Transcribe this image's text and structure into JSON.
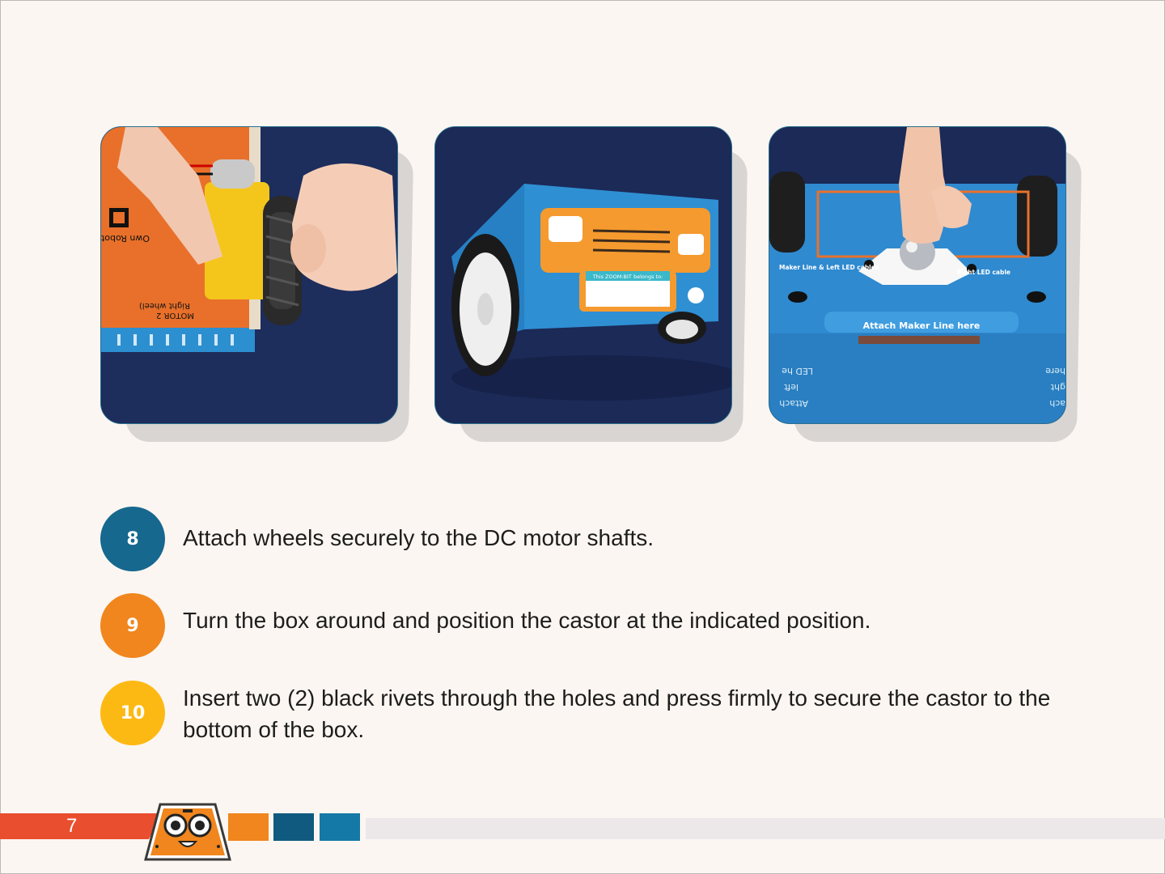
{
  "steps": [
    {
      "number": "8",
      "text": "Attach wheels securely to the DC motor shafts.",
      "color": "#16688e"
    },
    {
      "number": "9",
      "text": "Turn the box around and position the castor at the indicated position.",
      "color": "#f0861d"
    },
    {
      "number": "10",
      "text": "Insert two (2) black rivets through the holes and press firmly to secure the castor to the bottom of the box.",
      "color": "#fdb913"
    }
  ],
  "photos": {
    "photo1": {
      "motor_label": "MOTOR 2",
      "wheel_label": "Right wheel)",
      "robot_label": "Own Robot, for"
    },
    "photo2": {
      "plate_label": "This ZOOM:BIT belongs to:"
    },
    "photo3": {
      "attach_label": "Attach Maker Line here",
      "left_cable_label": "Maker Line & Left LED cables",
      "right_cable_label": "Right LED cable",
      "mirror_left_1": "LED he",
      "mirror_left_2": "left",
      "mirror_left_3": "Attach",
      "mirror_right_1": "here",
      "mirror_right_2": "ght",
      "mirror_right_3": "ach"
    }
  },
  "footer": {
    "page_number": "7",
    "colors": {
      "red": "#e94e2f",
      "orange": "#f0861d",
      "dark_blue": "#0f5a7e",
      "blue": "#1479a6",
      "grey": "#ece8ea"
    }
  }
}
